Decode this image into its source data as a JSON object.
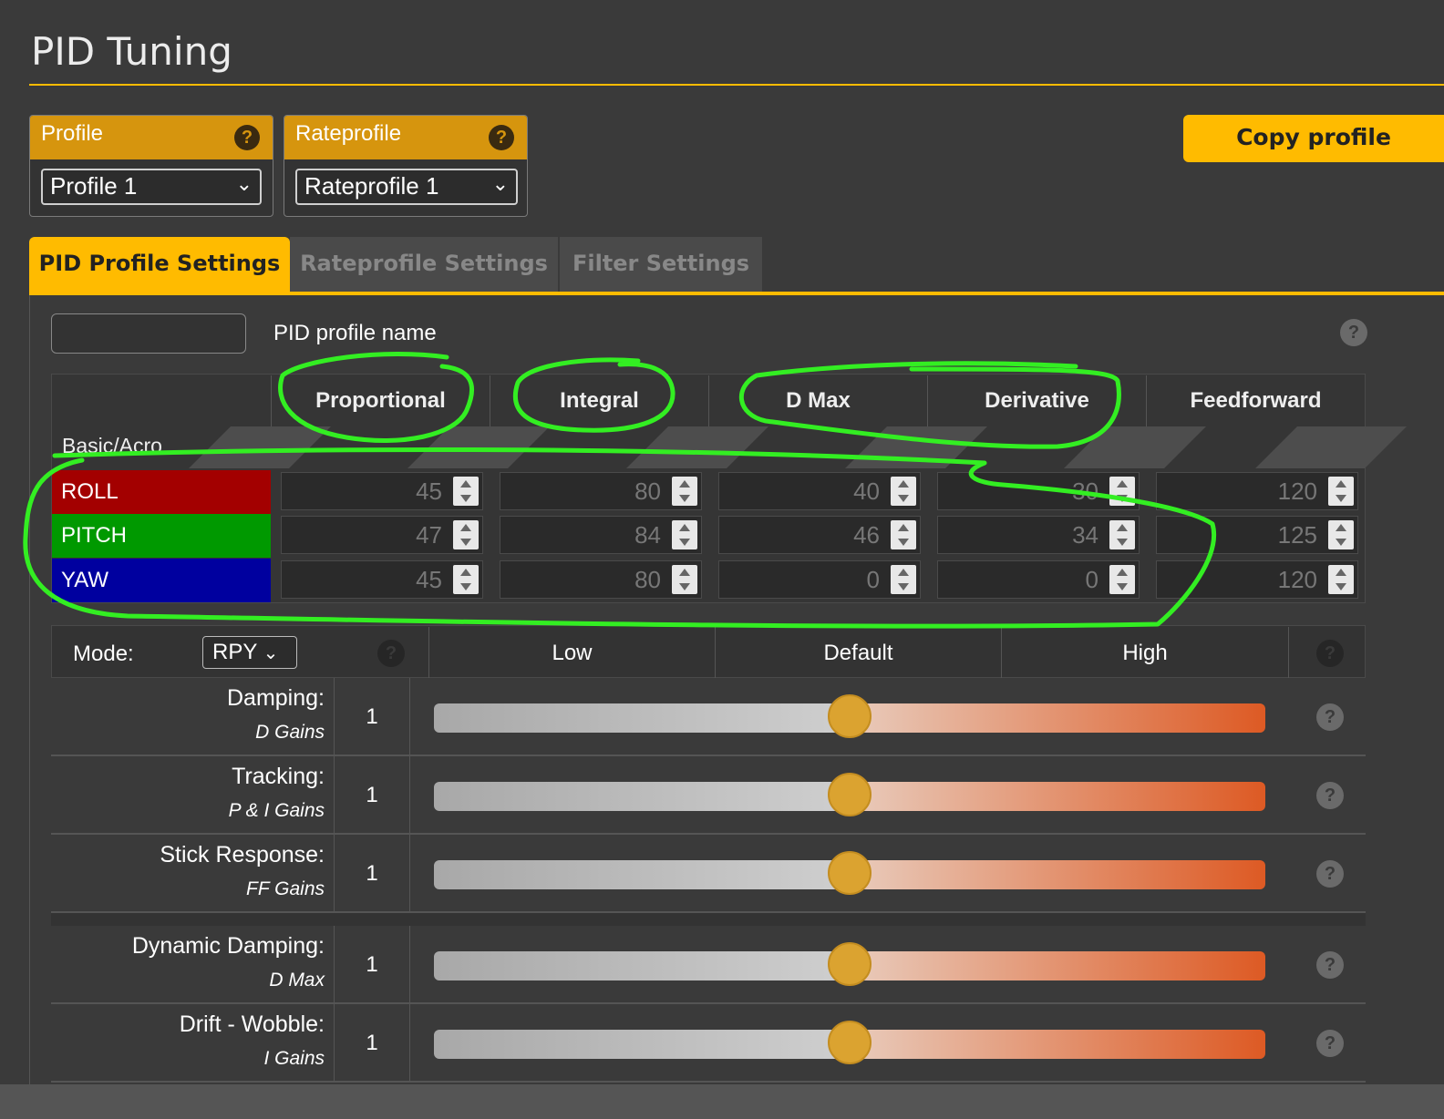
{
  "page": {
    "title": "PID Tuning"
  },
  "profile": {
    "label": "Profile",
    "value": "Profile 1"
  },
  "rateprofile": {
    "label": "Rateprofile",
    "value": "Rateprofile 1"
  },
  "copy_button": "Copy profile",
  "tabs": [
    {
      "label": "PID Profile Settings",
      "active": true
    },
    {
      "label": "Rateprofile Settings",
      "active": false
    },
    {
      "label": "Filter Settings",
      "active": false
    }
  ],
  "pid_profile_name": {
    "label": "PID profile name",
    "value": ""
  },
  "pid_table": {
    "columns": [
      "Proportional",
      "Integral",
      "D Max",
      "Derivative",
      "Feedforward"
    ],
    "section": "Basic/Acro",
    "rows": [
      {
        "axis": "ROLL",
        "color": "#a30000",
        "values": [
          "45",
          "80",
          "40",
          "30",
          "120"
        ]
      },
      {
        "axis": "PITCH",
        "color": "#009900",
        "values": [
          "47",
          "84",
          "46",
          "34",
          "125"
        ]
      },
      {
        "axis": "YAW",
        "color": "#00009f",
        "values": [
          "45",
          "80",
          "0",
          "0",
          "120"
        ]
      }
    ]
  },
  "sliders": {
    "mode_label": "Mode:",
    "mode_value": "RPY",
    "levels": [
      "Low",
      "Default",
      "High"
    ],
    "rows": [
      {
        "name": "Damping:",
        "sub": "D Gains",
        "value": "1",
        "position": 0.5
      },
      {
        "name": "Tracking:",
        "sub": "P & I Gains",
        "value": "1",
        "position": 0.5
      },
      {
        "name": "Stick Response:",
        "sub": "FF Gains",
        "value": "1",
        "position": 0.5
      },
      {
        "name": "Dynamic Damping:",
        "sub": "D Max",
        "value": "1",
        "position": 0.5
      },
      {
        "name": "Drift - Wobble:",
        "sub": "I Gains",
        "value": "1",
        "position": 0.5
      }
    ]
  },
  "colors": {
    "accent": "#ffbb00",
    "annotation": "#33ee22"
  }
}
